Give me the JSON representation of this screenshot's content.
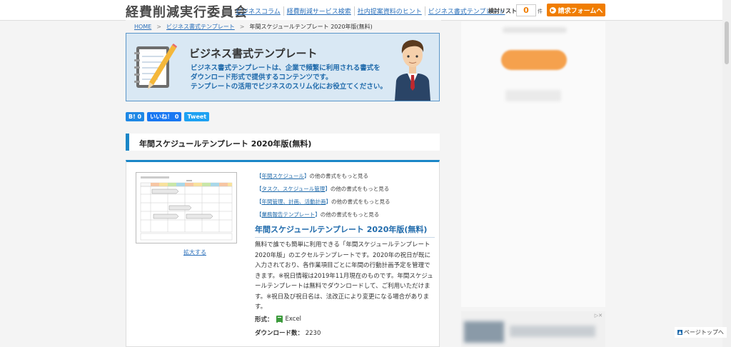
{
  "header": {
    "logo": "経費削減実行委員会",
    "nav": [
      "ビジネスコラム",
      "経費削減サービス検索",
      "社内提案資料のヒント",
      "ビジネス書式テンプレート"
    ],
    "review_list_label": "検討リスト",
    "review_count": "0",
    "count_unit": "件",
    "request_button": "請求フォームへ"
  },
  "breadcrumb": {
    "home": "HOME",
    "category": "ビジネス書式テンプレート",
    "current": "年間スケジュールテンプレート 2020年版(無料)"
  },
  "banner": {
    "title": "ビジネス書式テンプレート",
    "line1": "ビジネス書式テンプレートは、企業で頻繁に利用される書式を",
    "line2": "ダウンロード形式で提供するコンテンツです。",
    "line3": "テンプレートの活用でビジネスのスリム化にお役立てください。"
  },
  "social": {
    "hatena": "B! 0",
    "like": "いいね！ 0",
    "tweet": "Tweet"
  },
  "section_title": "年間スケジュールテンプレート 2020年版(無料)",
  "card": {
    "enlarge": "拡大する",
    "categories": [
      {
        "name": "年間スケジュール",
        "suffix": "の他の書式をもっと見る"
      },
      {
        "name": "タスク、スケジュール管理",
        "suffix": "の他の書式をもっと見る"
      },
      {
        "name": "年間管理、計画、活動計画",
        "suffix": "の他の書式をもっと見る"
      },
      {
        "name": "業務報告テンプレート",
        "suffix": "の他の書式をもっと見る"
      }
    ],
    "title": "年間スケジュールテンプレート 2020年版(無料)",
    "description": "無料で誰でも簡単に利用できる「年間スケジュールテンプレート2020年版」のエクセルテンプレートです。2020年の祝日が既に入力されており、各作業項目ごとに年間の行動計画予定を管理できます。※祝日情報は2019年11月現在のものです。年間スケジュールテンプレートは無料でダウンロードして、ご利用いただけます。※祝日及び祝日名は、法改正により変更になる場合があります。",
    "format_label": "形式：",
    "format_value": "Excel",
    "download_label": "ダウンロード数：",
    "download_count": "2230"
  },
  "pagetop": "ページトップへ",
  "colors": {
    "accent": "#1a86c7",
    "link": "#2a6fba",
    "orange": "#f07d00",
    "banner_bg": "#d9e8f4"
  }
}
